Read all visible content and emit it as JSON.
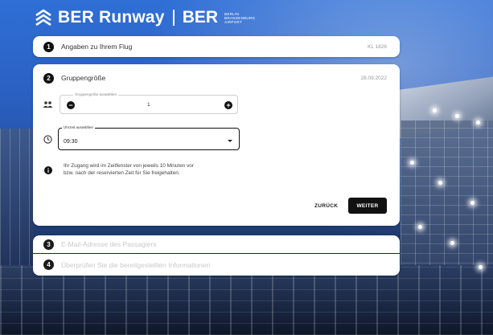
{
  "header": {
    "brand": "BER Runway",
    "ber": "BER",
    "ber_sub": [
      "BERLIN",
      "BRANDENBURG",
      "AIRPORT"
    ]
  },
  "steps": [
    {
      "number": "1",
      "title": "Angaben zu Ihrem Flug",
      "meta": "KL 1826"
    },
    {
      "number": "2",
      "title": "Gruppengröße",
      "meta": "28.09.2022"
    },
    {
      "number": "3",
      "title": "E-Mail-Adresse des Passagiers",
      "meta": ""
    },
    {
      "number": "4",
      "title": "Überprüfen Sie die bereitgestellten Informationen",
      "meta": ""
    }
  ],
  "group": {
    "legend": "Gruppengröße auswählen",
    "value": "1",
    "minus": "−",
    "plus": "+"
  },
  "time": {
    "legend": "Uhrzeit auswählen",
    "value": "09:30"
  },
  "info": {
    "line1": "Ihr Zugang wird im Zeitfenster von jeweils 10 Minuten vor",
    "line2": "bzw. nach der reservierten Zeit für Sie freigehalten."
  },
  "buttons": {
    "back": "ZURÜCK",
    "next": "WEITER"
  },
  "icons": {
    "logo": "chevron-stack-icon",
    "people": "people-icon",
    "clock": "clock-icon",
    "info": "info-icon"
  }
}
